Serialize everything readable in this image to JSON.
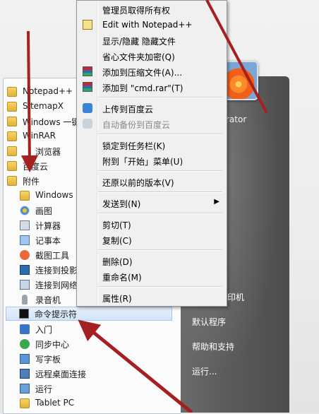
{
  "start_menu": {
    "programs": [
      {
        "label": "Notepad++",
        "icon": "folder-icon"
      },
      {
        "label": "SitemapX",
        "icon": "folder-icon"
      },
      {
        "label": "Windows 一键",
        "icon": "folder-icon"
      },
      {
        "label": "WinRAR",
        "icon": "folder-icon"
      },
      {
        "label": "浏览器",
        "icon": "folder-icon"
      },
      {
        "label": "百度云",
        "icon": "folder-icon"
      },
      {
        "label": "附件",
        "icon": "folder-icon"
      }
    ],
    "accessories": [
      {
        "label": "Windows",
        "icon": "windows-icon"
      },
      {
        "label": "画图",
        "icon": "paint-icon"
      },
      {
        "label": "计算器",
        "icon": "calculator-icon"
      },
      {
        "label": "记事本",
        "icon": "notepad-icon"
      },
      {
        "label": "截图工具",
        "icon": "snipping-tool-icon"
      },
      {
        "label": "连接到投影",
        "icon": "projector-icon"
      },
      {
        "label": "连接到网络",
        "icon": "network-projector-icon"
      },
      {
        "label": "录音机",
        "icon": "microphone-icon"
      },
      {
        "label": "命令提示符",
        "icon": "cmd-icon"
      },
      {
        "label": "入门",
        "icon": "getting-started-icon"
      },
      {
        "label": "同步中心",
        "icon": "sync-icon"
      },
      {
        "label": "写字板",
        "icon": "wordpad-icon"
      },
      {
        "label": "远程桌面连接",
        "icon": "remote-desktop-icon"
      },
      {
        "label": "运行",
        "icon": "run-icon"
      },
      {
        "label": "Tablet PC",
        "icon": "folder-icon"
      }
    ],
    "right_panel": {
      "user_fragment": "rator",
      "printers_fragment": "印机",
      "items": [
        "默认程序",
        "帮助和支持",
        "运行..."
      ]
    }
  },
  "context_menu": {
    "items": [
      {
        "label": "管理员取得所有权",
        "icon": ""
      },
      {
        "label": "Edit with Notepad++",
        "icon": "notepad-plus-icon"
      },
      {
        "label": "显示/隐藏 隐藏文件",
        "icon": ""
      },
      {
        "label": "省心文件夹加密(Q)",
        "icon": ""
      },
      {
        "label": "添加到压缩文件(A)...",
        "icon": "winrar-icon"
      },
      {
        "label": "添加到 \"cmd.rar\"(T)",
        "icon": "winrar-icon"
      },
      {
        "label": "上传到百度云",
        "icon": "baidu-cloud-icon"
      },
      {
        "label": "自动备份到百度云",
        "icon": "baidu-cloud-disabled-icon",
        "disabled": true
      },
      {
        "label": "锁定到任务栏(K)",
        "icon": ""
      },
      {
        "label": "附到「开始」菜单(U)",
        "icon": ""
      },
      {
        "label": "还原以前的版本(V)",
        "icon": ""
      },
      {
        "label": "发送到(N)",
        "icon": "",
        "submenu": true
      },
      {
        "label": "剪切(T)",
        "icon": ""
      },
      {
        "label": "复制(C)",
        "icon": ""
      },
      {
        "label": "删除(D)",
        "icon": ""
      },
      {
        "label": "重命名(M)",
        "icon": ""
      },
      {
        "label": "属性(R)",
        "icon": ""
      }
    ],
    "submenu_arrow": "▶"
  },
  "colors": {
    "annotation_arrow": "#a52020",
    "highlight": "#d3e4f7"
  }
}
